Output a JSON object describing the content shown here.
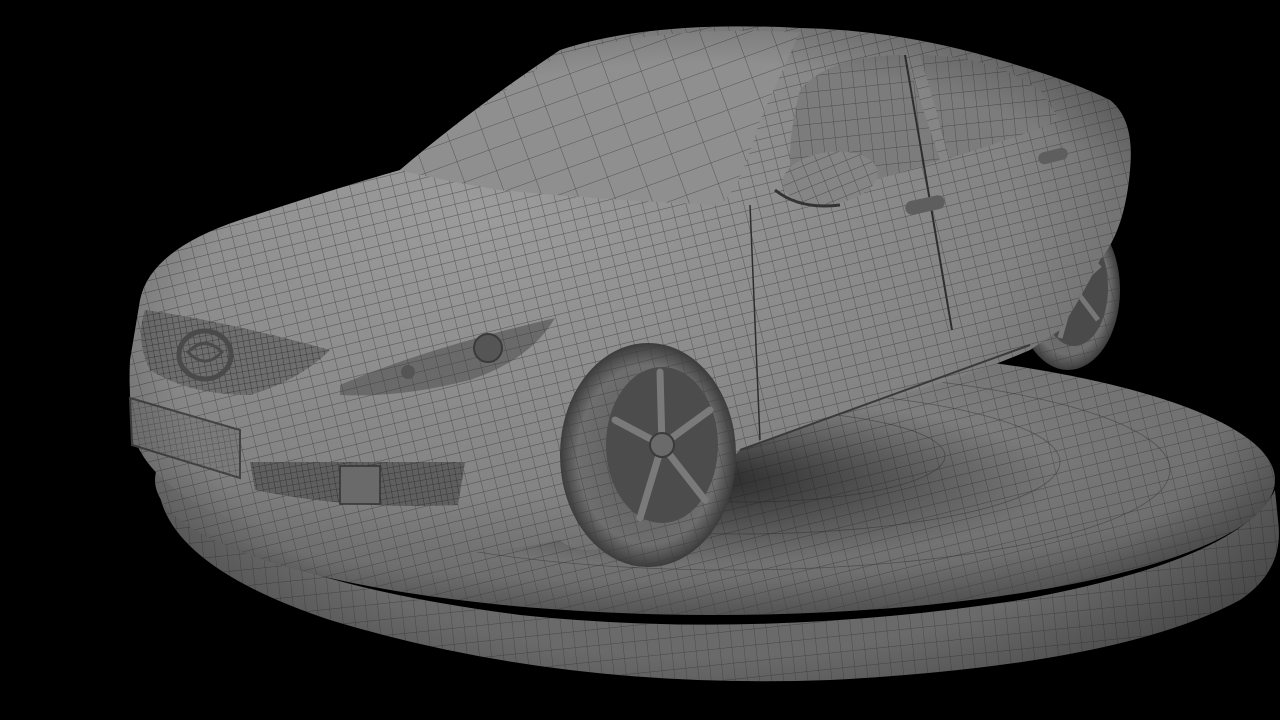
{
  "render": {
    "subject": "car-wireframe-render",
    "background_color": "#000000",
    "surface_color": "#8a8a8a",
    "wire_color": "#3a3a3a"
  }
}
